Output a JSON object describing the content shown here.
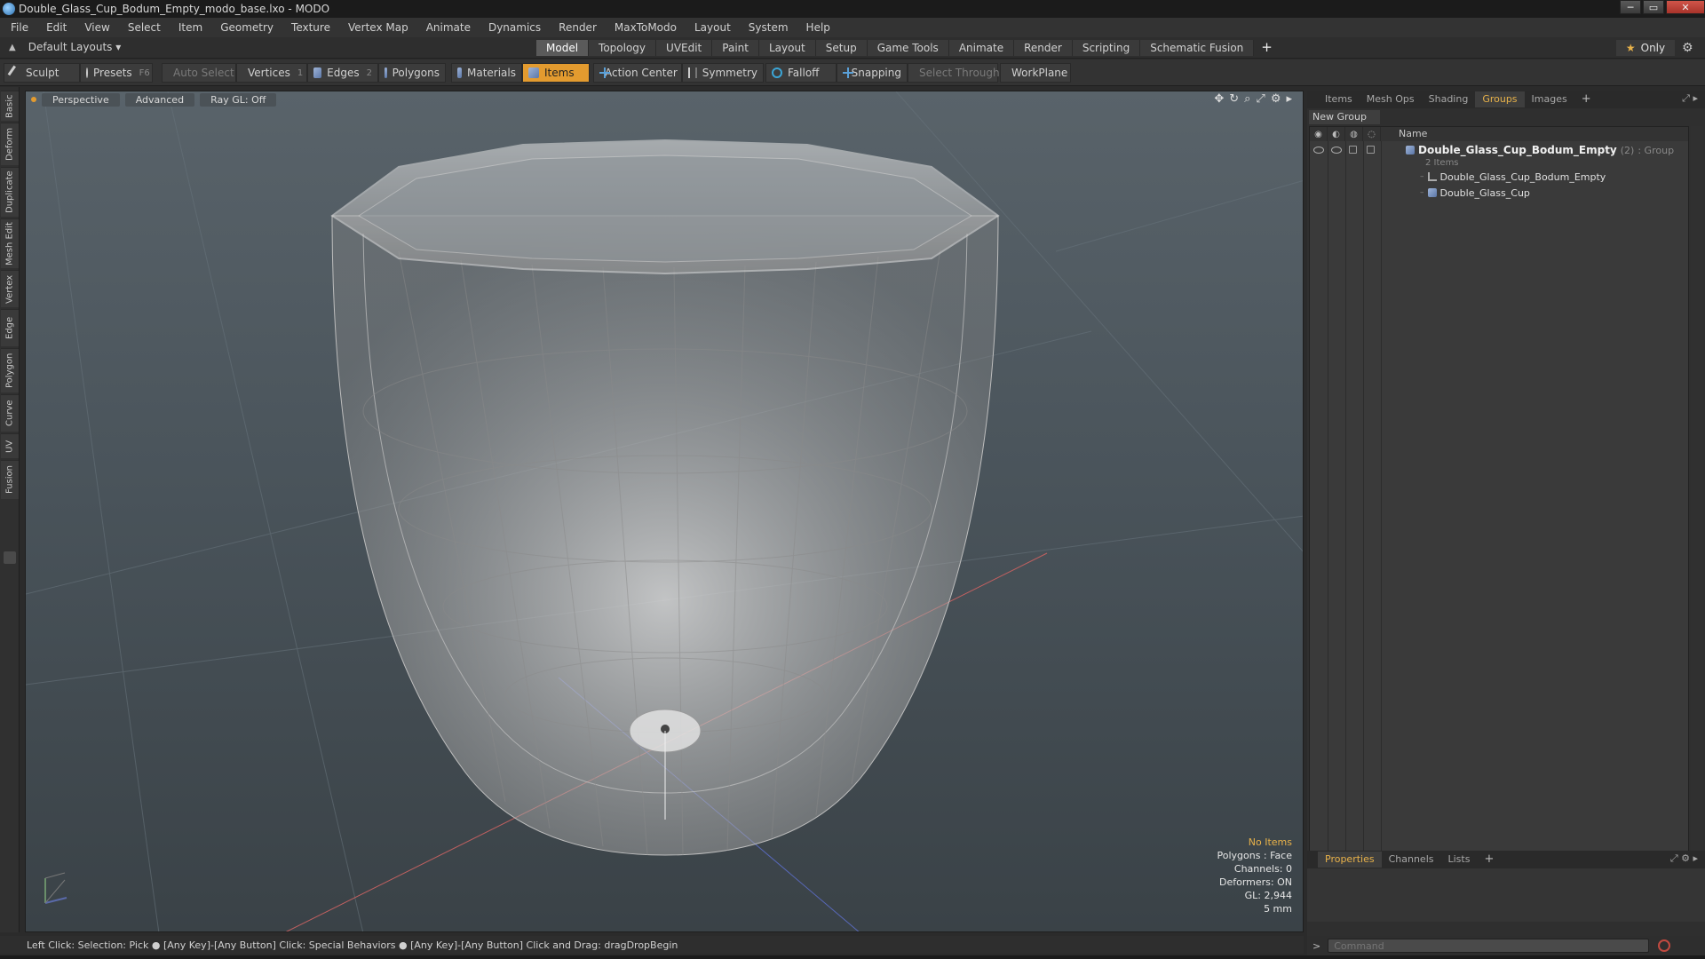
{
  "window": {
    "title": "Double_Glass_Cup_Bodum_Empty_modo_base.lxo - MODO",
    "controls": [
      "─",
      "▭",
      "✕"
    ]
  },
  "menu": [
    "File",
    "Edit",
    "View",
    "Select",
    "Item",
    "Geometry",
    "Texture",
    "Vertex Map",
    "Animate",
    "Dynamics",
    "Render",
    "MaxToModo",
    "Layout",
    "System",
    "Help"
  ],
  "layout_bar": {
    "layout_label": "Default Layouts ▾",
    "tabs": [
      "Model",
      "Topology",
      "UVEdit",
      "Paint",
      "Layout",
      "Setup",
      "Game Tools",
      "Animate",
      "Render",
      "Scripting",
      "Schematic Fusion"
    ],
    "active_tab": "Model",
    "add_tab": "+",
    "only_label": "Only"
  },
  "toolbar": {
    "sculpt": "Sculpt",
    "presets": "Presets",
    "presets_key": "F6",
    "auto_select": "Auto Select",
    "vertices": "Vertices",
    "vertices_key": "1",
    "edges": "Edges",
    "edges_key": "2",
    "polygons": "Polygons",
    "materials": "Materials",
    "items": "Items",
    "action_center": "Action Center",
    "symmetry": "Symmetry",
    "falloff": "Falloff",
    "snapping": "Snapping",
    "select_through": "Select Through",
    "workplane": "WorkPlane"
  },
  "left_tabs": [
    "Basic",
    "Deform",
    "Duplicate",
    "Mesh Edit",
    "Vertex",
    "Edge",
    "Polygon",
    "Curve",
    "UV",
    "Fusion"
  ],
  "viewport": {
    "view_mode": "Perspective",
    "shading": "Advanced",
    "raygl": "Ray GL: Off",
    "info": {
      "no_items": "No Items",
      "polygons": "Polygons : Face",
      "channels": "Channels: 0",
      "deformers": "Deformers: ON",
      "gl": "GL: 2,944",
      "scale": "5 mm"
    }
  },
  "status_bar": "Left Click: Selection: Pick ● [Any Key]-[Any Button] Click: Special Behaviors ● [Any Key]-[Any Button] Click and Drag: dragDropBegin",
  "right_panel": {
    "tabs": [
      "Items",
      "Mesh Ops",
      "Shading",
      "Groups",
      "Images"
    ],
    "active_tab": "Groups",
    "add_tab": "+",
    "new_group": "New Group",
    "column_name": "Name",
    "group": {
      "name": "Double_Glass_Cup_Bodum_Empty",
      "count": "(2)",
      "type": ": Group",
      "subtitle": "2 Items",
      "children": [
        "Double_Glass_Cup_Bodum_Empty",
        "Double_Glass_Cup"
      ]
    },
    "props_tabs": [
      "Properties",
      "Channels",
      "Lists"
    ],
    "props_active": "Properties",
    "command_placeholder": "Command"
  }
}
